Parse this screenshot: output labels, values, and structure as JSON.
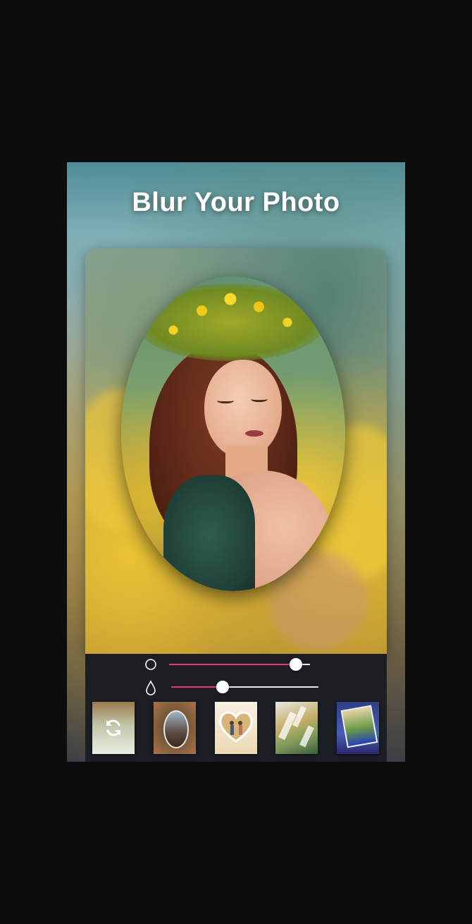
{
  "title": "Blur Your Photo",
  "colors": {
    "slider_accent": "#e8386b",
    "panel_background": "#1b1f23",
    "page_background": "#0d0d0d"
  },
  "sliders": [
    {
      "id": "blur-radius",
      "icon": "circle-icon",
      "value": 0.9
    },
    {
      "id": "blur-intensity",
      "icon": "droplet-icon",
      "value": 0.35
    }
  ],
  "thumbnails": [
    {
      "id": "refresh",
      "icon": "refresh-icon"
    },
    {
      "id": "oval-frame"
    },
    {
      "id": "heart-frame"
    },
    {
      "id": "splash-effect"
    },
    {
      "id": "tilted-photo"
    }
  ]
}
